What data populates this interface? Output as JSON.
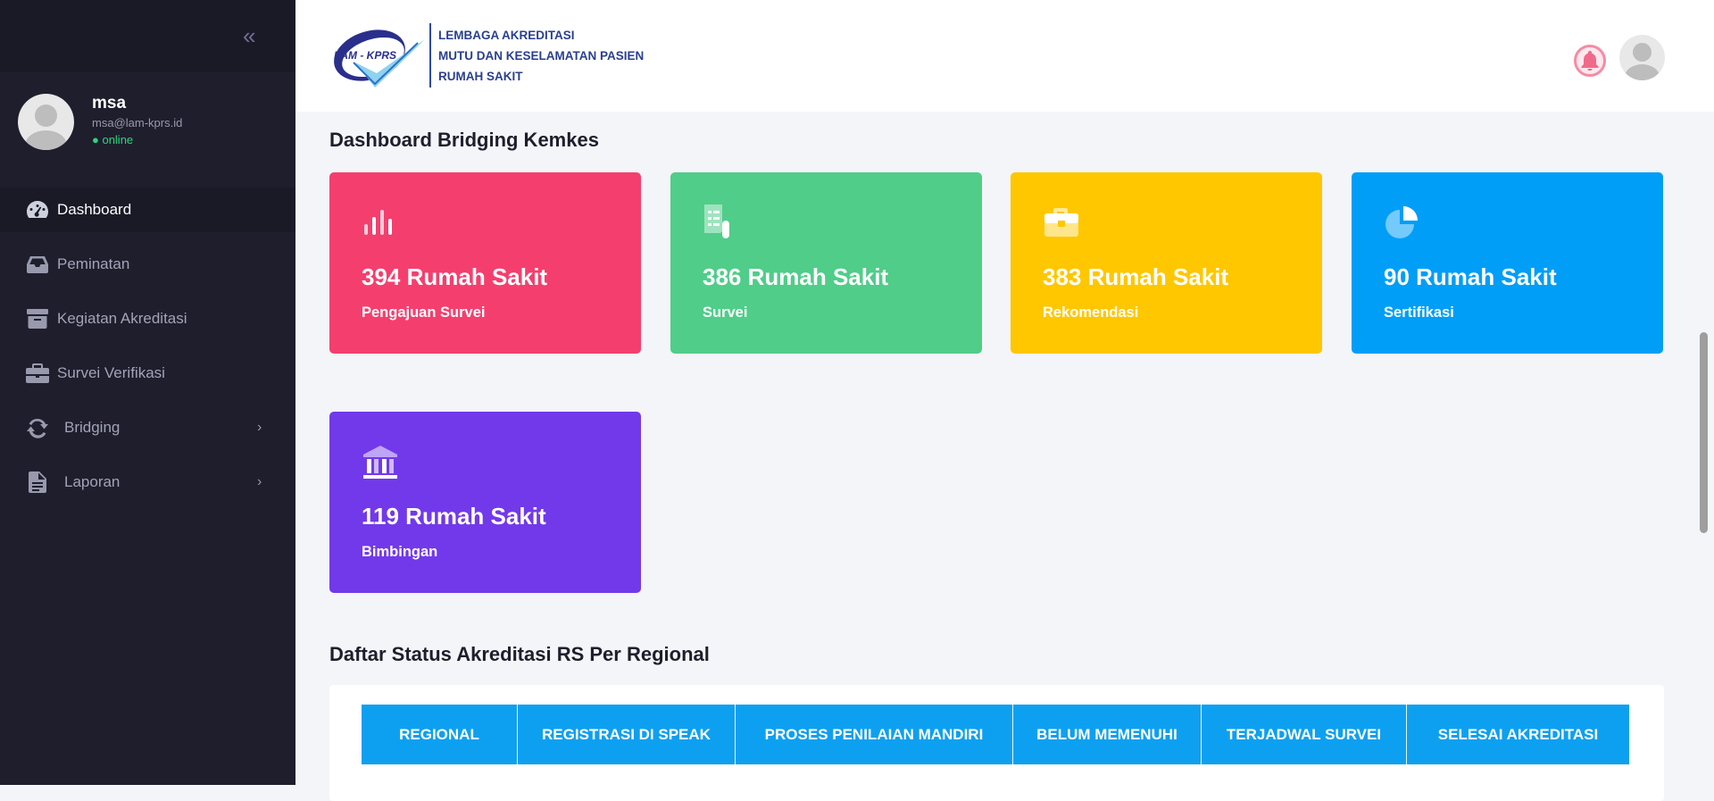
{
  "sidebar": {
    "profile": {
      "name": "msa",
      "email": "msa@lam-kprs.id",
      "status": "● online"
    },
    "items": [
      {
        "label": "Dashboard",
        "icon": "gauge-icon",
        "active": true
      },
      {
        "label": "Peminatan",
        "icon": "inbox-icon"
      },
      {
        "label": "Kegiatan Akreditasi",
        "icon": "archive-icon"
      },
      {
        "label": "Survei Verifikasi",
        "icon": "briefcase-icon"
      },
      {
        "label": "Bridging",
        "icon": "sync-icon",
        "chevron": "›"
      },
      {
        "label": "Laporan",
        "icon": "document-icon",
        "chevron": "›"
      }
    ],
    "collapse_glyph": "«"
  },
  "header": {
    "logo_mark_text": "LAM - KPRS",
    "logo_lines": [
      "LEMBAGA AKREDITASI",
      "MUTU DAN KESELAMATAN PASIEN",
      "RUMAH SAKIT"
    ]
  },
  "dashboard": {
    "title": "Dashboard Bridging Kemkes",
    "cards": [
      {
        "value": "394 Rumah Sakit",
        "label": "Pengajuan Survei",
        "color": "#f43f6e",
        "icon": "bar-chart-icon"
      },
      {
        "value": "386 Rumah Sakit",
        "label": "Survei",
        "color": "#50cd89",
        "icon": "survey-icon"
      },
      {
        "value": "383 Rumah Sakit",
        "label": "Rekomendasi",
        "color": "#ffc700",
        "icon": "briefcase-icon"
      },
      {
        "value": "90 Rumah Sakit",
        "label": "Sertifikasi",
        "color": "#009ef7",
        "icon": "pie-chart-icon"
      },
      {
        "value": "119 Rumah Sakit",
        "label": "Bimbingan",
        "color": "#7239ea",
        "icon": "institution-icon"
      }
    ]
  },
  "status_table": {
    "title": "Daftar Status Akreditasi RS Per Regional",
    "headers": [
      "REGIONAL",
      "REGISTRASI DI SPEAK",
      "PROSES PENILAIAN MANDIRI",
      "BELUM MEMENUHI",
      "TERJADWAL SURVEI",
      "SELESAI AKREDITASI"
    ]
  }
}
